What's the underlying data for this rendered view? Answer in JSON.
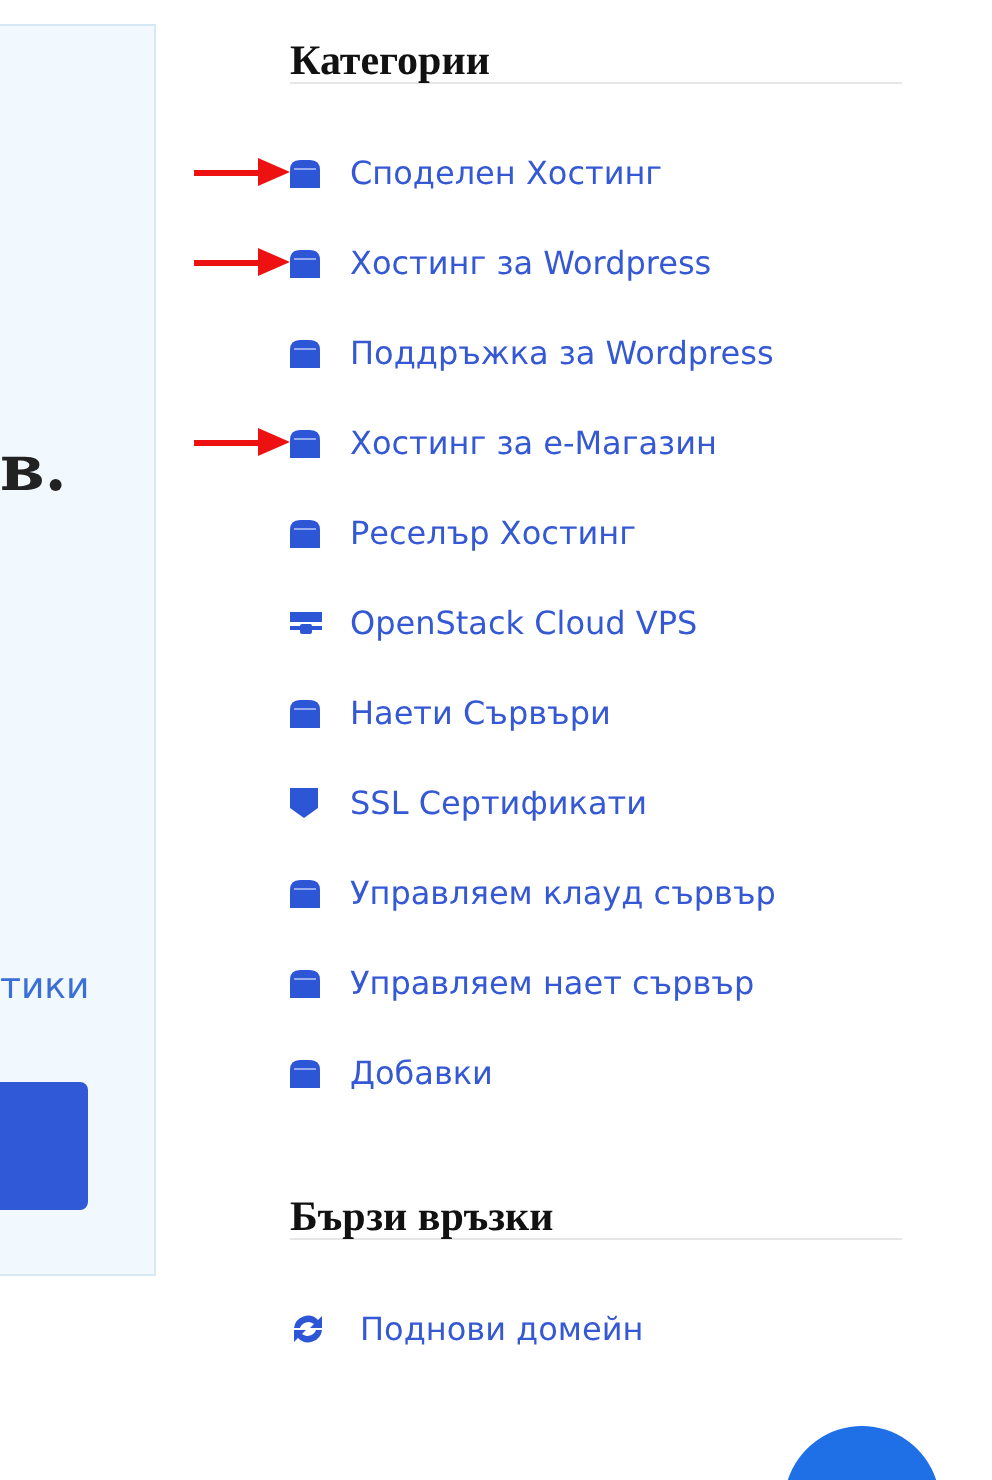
{
  "left_panel": {
    "heading_fragment": "в.",
    "link_fragment": "тики"
  },
  "categories": {
    "title": "Категории",
    "items": [
      {
        "label": "Споделен Хостинг",
        "kind": "box",
        "marked": true
      },
      {
        "label": "Хостинг за Wordpress",
        "kind": "box",
        "marked": true
      },
      {
        "label": "Поддръжка за Wordpress",
        "kind": "box",
        "marked": false
      },
      {
        "label": "Хостинг за е-Магазин",
        "kind": "box",
        "marked": true
      },
      {
        "label": "Реселър Хостинг",
        "kind": "box",
        "marked": false
      },
      {
        "label": "OpenStack Cloud VPS",
        "kind": "server",
        "marked": false
      },
      {
        "label": "Наети Сървъри",
        "kind": "box",
        "marked": false
      },
      {
        "label": "SSL Сертификати",
        "kind": "shield",
        "marked": false
      },
      {
        "label": "Управляем клауд сървър",
        "kind": "box",
        "marked": false
      },
      {
        "label": "Управляем нает сървър",
        "kind": "box",
        "marked": false
      },
      {
        "label": "Добавки",
        "kind": "box",
        "marked": false
      }
    ]
  },
  "quick_links": {
    "title": "Бързи връзки",
    "items": [
      {
        "label": "Поднови домейн",
        "kind": "refresh"
      }
    ]
  }
}
